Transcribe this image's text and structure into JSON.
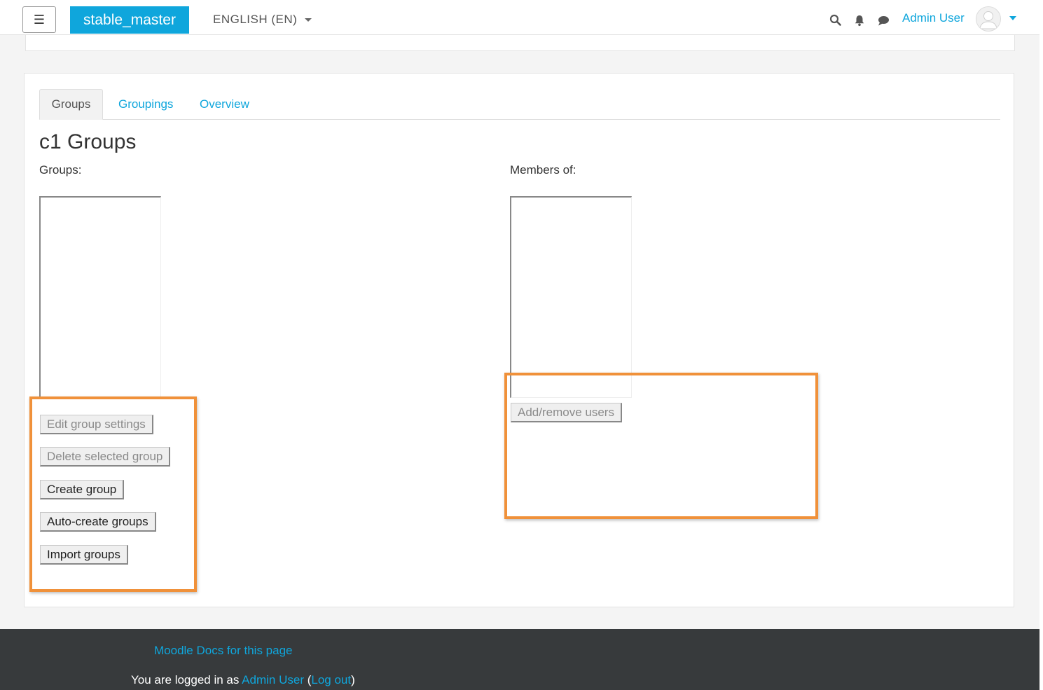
{
  "navbar": {
    "toggle_icon": "☰",
    "brand": "stable_master",
    "language": "ENGLISH (EN)",
    "icons": [
      "search-icon",
      "bell-icon",
      "chat-icon"
    ],
    "user_name": "Admin User",
    "accent_color": "#0fa6dc"
  },
  "tabs": [
    {
      "label": "Groups",
      "active": true
    },
    {
      "label": "Groupings",
      "active": false
    },
    {
      "label": "Overview",
      "active": false
    }
  ],
  "page": {
    "title": "c1 Groups",
    "groups_label": "Groups:",
    "members_label": "Members of:"
  },
  "group_buttons": {
    "edit": "Edit group settings",
    "delete": "Delete selected group",
    "create": "Create group",
    "auto_create": "Auto-create groups",
    "import": "Import groups"
  },
  "member_buttons": {
    "add_remove": "Add/remove users"
  },
  "highlight_color": "#f0913a",
  "footer": {
    "docs_link": "Moodle Docs for this page",
    "logged_in_prefix": "You are logged in as ",
    "user_link": "Admin User",
    "open_paren": " (",
    "logout_link": "Log out",
    "close_paren": ")"
  }
}
